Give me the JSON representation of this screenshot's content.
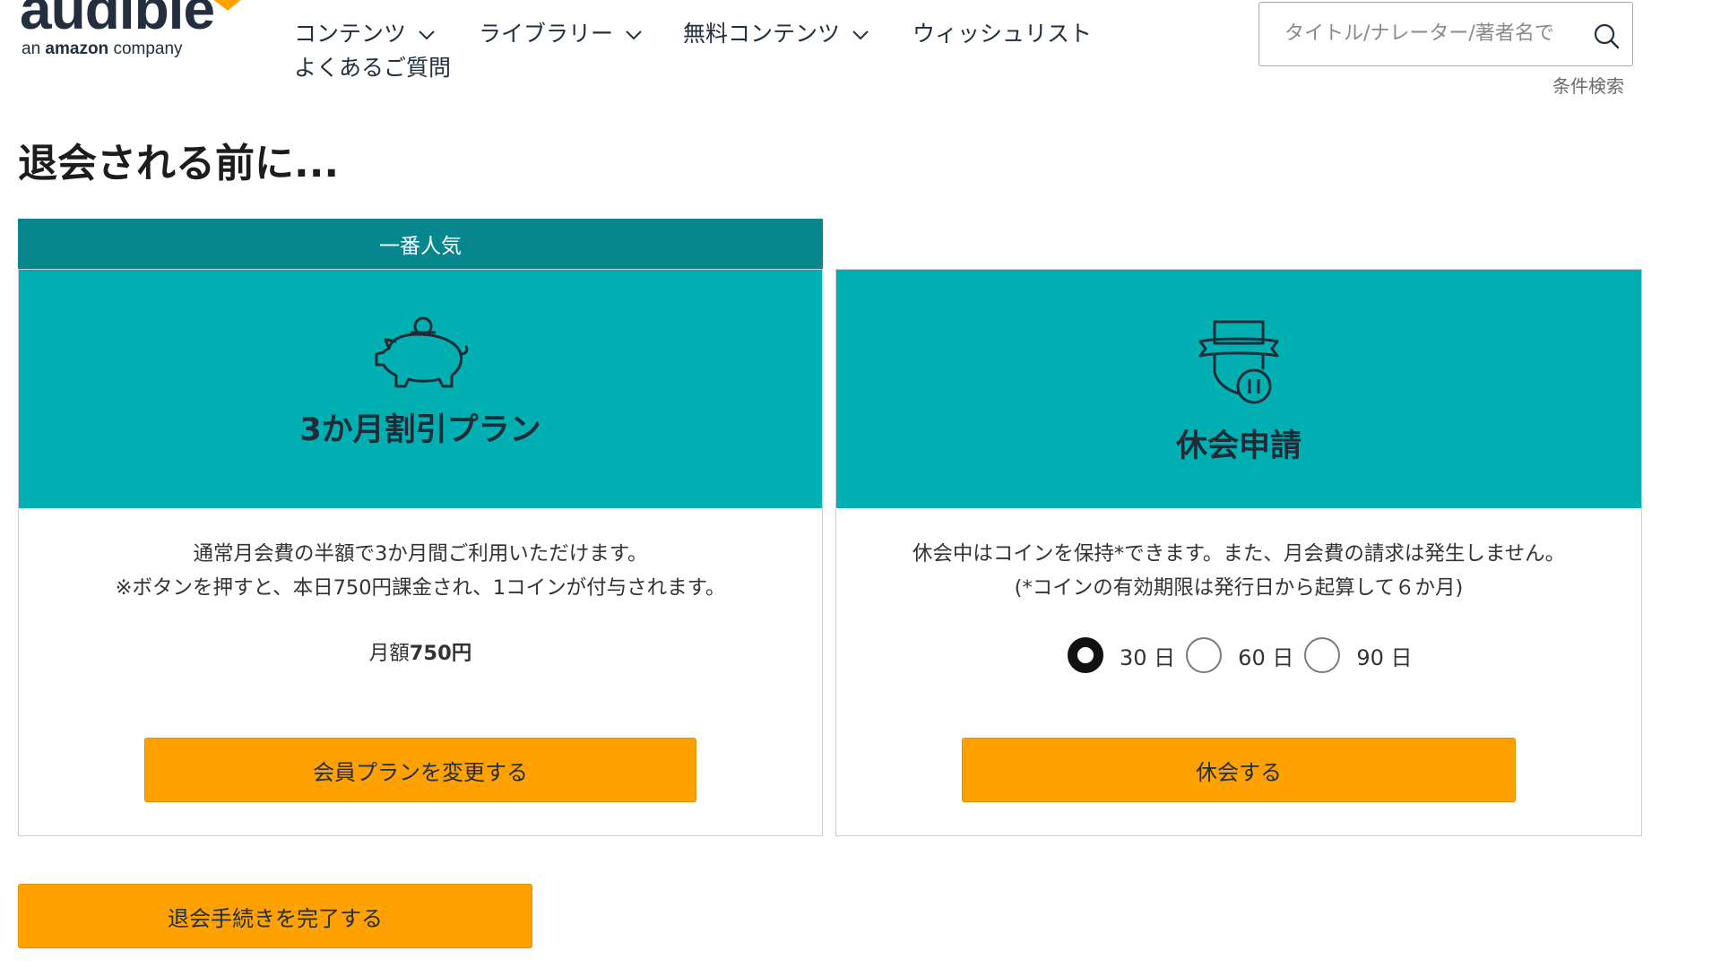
{
  "brand": {
    "logo_word": "audible",
    "tagline_prefix": "an ",
    "tagline_brand": "amazon",
    "tagline_suffix": " company",
    "accent_color": "#ffa200"
  },
  "nav": {
    "items": [
      {
        "label": "コンテンツ",
        "has_dropdown": true,
        "icon": "chevron-down-icon"
      },
      {
        "label": "ライブラリー",
        "has_dropdown": true,
        "icon": "chevron-down-icon"
      },
      {
        "label": "無料コンテンツ",
        "has_dropdown": true,
        "icon": "chevron-down-icon"
      },
      {
        "label": "ウィッシュリスト",
        "has_dropdown": false
      },
      {
        "label": "よくあるご質問",
        "has_dropdown": false
      }
    ]
  },
  "search": {
    "placeholder": "タイトル/ナレーター/著者名で",
    "value": "",
    "icon": "search-icon",
    "advanced_label": "条件検索"
  },
  "page": {
    "title": "退会される前に..."
  },
  "offers": {
    "discount": {
      "ribbon": "一番人気",
      "icon": "piggy-bank-icon",
      "title": "3か月割引プラン",
      "description_line1": "通常月会費の半額で3か月間ご利用いただけます。",
      "description_line2": "※ボタンを押すと、本日750円課金され、1コインが付与されます。",
      "price_prefix": "月額",
      "price_value": "750円",
      "button_label": "会員プランを変更する",
      "header_color": "#00afb2",
      "ribbon_color": "#07868d"
    },
    "pause": {
      "icon": "pause-badge-icon",
      "title": "休会申請",
      "description_line1": "休会中はコインを保持*できます。また、月会費の請求は発生しません。",
      "description_line2": "(*コインの有効期限は発行日から起算して６か月)",
      "duration_options": [
        {
          "label": "30 日",
          "selected": true
        },
        {
          "label": "60 日",
          "selected": false
        },
        {
          "label": "90 日",
          "selected": false
        }
      ],
      "button_label": "休会する"
    }
  },
  "cancel": {
    "button_label": "退会手続きを完了する"
  }
}
